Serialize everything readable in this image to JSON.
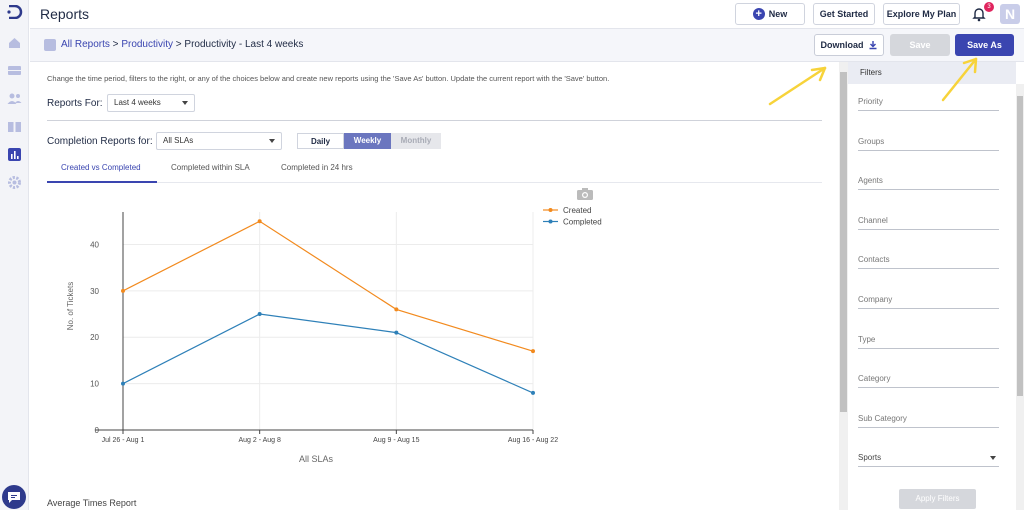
{
  "app": {
    "title": "Reports",
    "avatar_initial": "N",
    "notification_count": "3"
  },
  "topbar": {
    "new_label": "New",
    "get_started_label": "Get Started",
    "explore_label": "Explore My Plan"
  },
  "breadcrumb": {
    "all_reports": "All Reports",
    "sep1": " > ",
    "productivity": "Productivity",
    "current": " > Productivity - Last 4 weeks"
  },
  "actions": {
    "download_label": "Download",
    "save_label": "Save",
    "save_as_label": "Save As"
  },
  "intro_text": "Change the time period, filters to the right, or any of the choices below and create new reports using the 'Save As' button. Update the current report with the 'Save' button.",
  "reports_for": {
    "label": "Reports For:",
    "value": "Last 4 weeks"
  },
  "completion": {
    "label": "Completion Reports for:",
    "value": "All SLAs"
  },
  "period_toggle": {
    "daily": "Daily",
    "weekly": "Weekly",
    "monthly": "Monthly",
    "selected": "Weekly"
  },
  "tabs": [
    {
      "label": "Created vs Completed",
      "active": true
    },
    {
      "label": "Completed within SLA",
      "active": false
    },
    {
      "label": "Completed in 24 hrs",
      "active": false
    }
  ],
  "chart_data": {
    "type": "line",
    "categories": [
      "Jul 26 - Aug 1",
      "Aug 2 - Aug 8",
      "Aug 9 - Aug 15",
      "Aug 16 - Aug 22"
    ],
    "series": [
      {
        "name": "Created",
        "values": [
          30,
          45,
          26,
          17
        ],
        "color": "#f28a1e"
      },
      {
        "name": "Completed",
        "values": [
          10,
          25,
          21,
          8
        ],
        "color": "#2e80b8"
      }
    ],
    "xlabel": "All SLAs",
    "ylabel": "No. of Tickets",
    "ylim": [
      0,
      47
    ],
    "yticks": [
      0,
      10,
      20,
      30,
      40
    ],
    "grid": true,
    "legend_position": "top-right"
  },
  "next_section": {
    "title": "Average Times Report"
  },
  "filters": {
    "title": "Filters",
    "fields": [
      "Priority",
      "Groups",
      "Agents",
      "Channel",
      "Contacts",
      "Company",
      "Type",
      "Category",
      "Sub Category",
      "Sports"
    ],
    "apply_label": "Apply Filters"
  },
  "colors": {
    "accent": "#3a45b0",
    "annotation_arrow": "#f7d33a"
  }
}
